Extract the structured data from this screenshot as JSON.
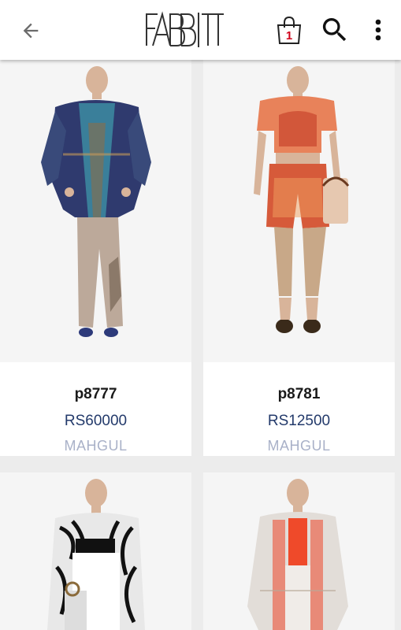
{
  "header": {
    "logo_text": "FABBITT",
    "cart_count": "1",
    "icons": [
      "arrow-back-icon",
      "shopping-bag-icon",
      "search-icon",
      "more-vert-icon"
    ]
  },
  "products": [
    {
      "name": "p8777",
      "price": "RS60000",
      "brand": "MAHGUL"
    },
    {
      "name": "p8781",
      "price": "RS12500",
      "brand": "MAHGUL"
    },
    {
      "name": "",
      "price": "",
      "brand": ""
    },
    {
      "name": "",
      "price": "",
      "brand": ""
    }
  ],
  "colors": {
    "price": "#233a6b",
    "brand": "#a9b1c8",
    "cart_badge": "#d0021b",
    "background": "#ececec"
  }
}
